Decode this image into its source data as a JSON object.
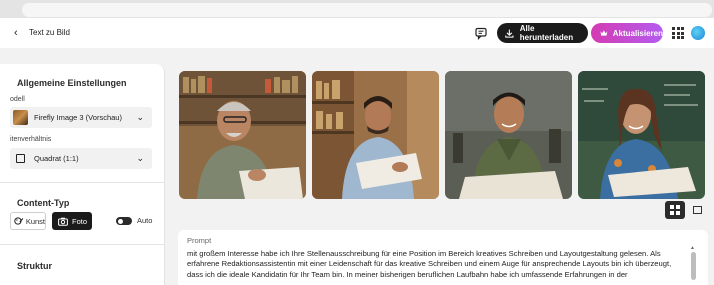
{
  "header": {
    "back_label": "Text zu Bild",
    "download_label": "Alle herunterladen",
    "update_label": "Aktualisieren"
  },
  "sidebar": {
    "general_heading": "Allgemeine Einstellungen",
    "model_label": "odell",
    "model_value": "Firefly Image 3 (Vorschau)",
    "ratio_label": "itenverhältnis",
    "ratio_value": "Quadrat (1:1)",
    "content_type_heading": "Content-Typ",
    "art_label": "Kunst",
    "photo_label": "Foto",
    "auto_label": "Auto",
    "structure_heading": "Struktur"
  },
  "prompt": {
    "label": "Prompt",
    "text": "mit großem Interesse habe ich Ihre Stellenausschreibung für eine Position im Bereich kreatives Schreiben und Layoutgestaltung gelesen. Als erfahrene Redaktionsassistentin mit einer Leidenschaft für das kreative Schreiben und einem Auge für ansprechende Layouts bin ich überzeugt, dass ich die ideale Kandidatin für Ihr Team bin. In meiner bisherigen beruflichen Laufbahn habe ich umfassende Erfahrungen in der"
  },
  "colors": {
    "accent_gradient_start": "#d43bb2",
    "accent_gradient_end": "#b45cf0",
    "dark_button": "#1b1b1b"
  },
  "icons": [
    "back-chevron-icon",
    "chat-icon",
    "download-icon",
    "crown-icon",
    "apps-grid-icon",
    "chevron-down-icon",
    "square-icon",
    "art-icon",
    "camera-icon",
    "grid-view-icon",
    "single-view-icon"
  ]
}
